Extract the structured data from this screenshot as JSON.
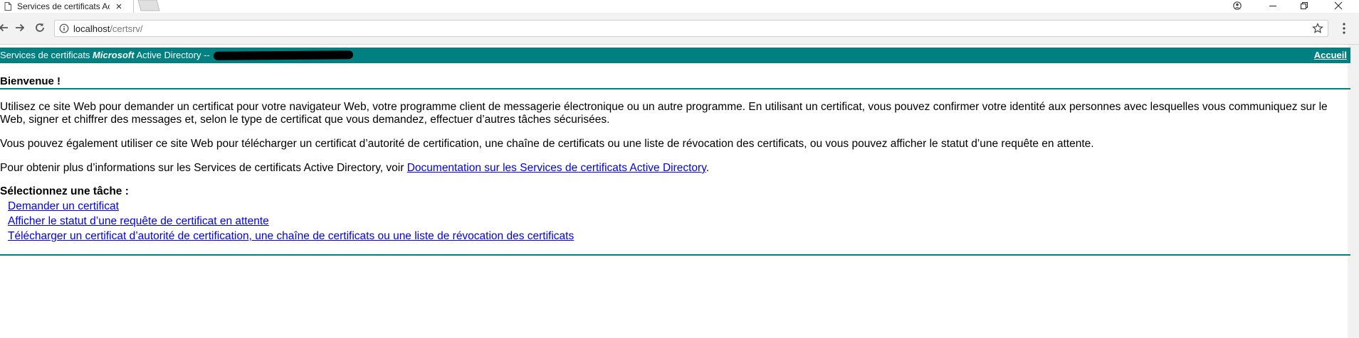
{
  "browser": {
    "tab_title": "Services de certificats Ac",
    "url_host": "localhost",
    "url_path": "/certsrv/"
  },
  "banner": {
    "brand_prefix": "Services de certificats ",
    "brand_vendor": "Microsoft",
    "brand_suffix": " Active Directory  --",
    "home_link": "Accueil",
    "bg_color": "#008080"
  },
  "page": {
    "heading": "Bienvenue !",
    "para1": "Utilisez ce site Web pour demander un certificat pour votre navigateur Web, votre programme client de messagerie électronique ou un autre programme. En utilisant un certificat, vous pouvez confirmer votre identité aux personnes avec lesquelles vous communiquez sur le Web, signer et chiffrer des messages et, selon le type de certificat que vous demandez, effectuer d’autres tâches sécurisées.",
    "para2": "Vous pouvez également utiliser ce site Web pour télécharger un certificat d’autorité de certification, une chaîne de certificats ou une liste de révocation des certificats, ou vous pouvez afficher le statut d’une requête en attente.",
    "para3_prefix": "Pour obtenir plus d’informations sur les Services de certificats Active Directory, voir ",
    "para3_link": "Documentation sur les Services de certificats Active Directory",
    "para3_suffix": ".",
    "task_title": "Sélectionnez une tâche :",
    "tasks": [
      "Demander un certificat",
      "Afficher le statut d’une requête de certificat en attente",
      "Télécharger un certificat d’autorité de certification, une chaîne de certificats ou une liste de révocation des certificats"
    ],
    "link_color": "#0000ee"
  },
  "icons": {
    "favicon": "page-icon",
    "tab_close": "close-icon",
    "back": "back-arrow-icon",
    "forward": "forward-arrow-icon",
    "reload": "reload-icon",
    "info": "info-icon",
    "bookmark": "star-icon",
    "menu": "kebab-menu-icon",
    "profile": "profile-icon",
    "minimize": "minimize-icon",
    "restore": "restore-icon",
    "close_window": "close-window-icon"
  }
}
